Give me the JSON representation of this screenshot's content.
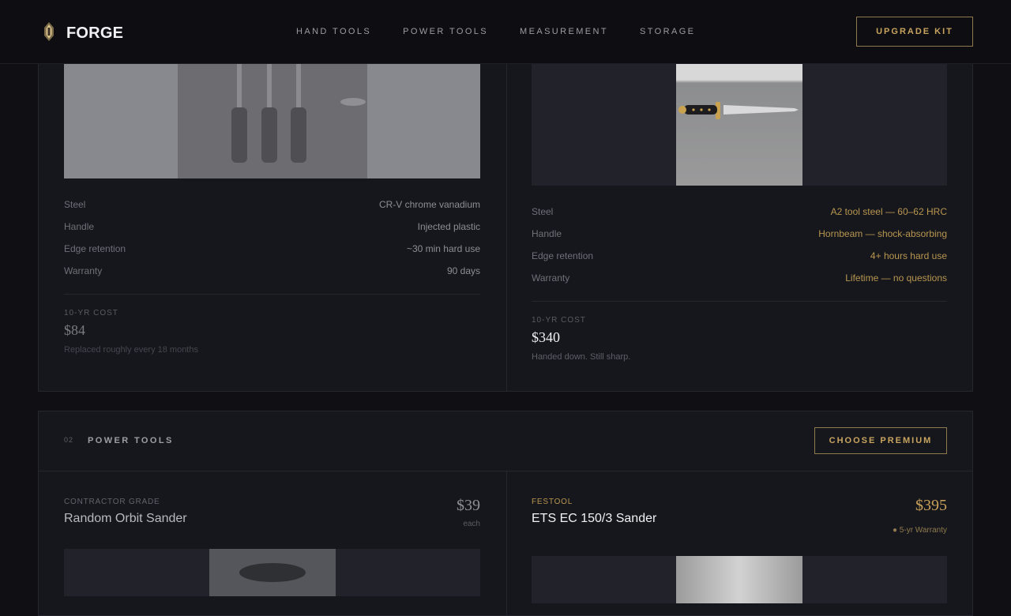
{
  "header": {
    "brand": "FORGE",
    "nav": [
      "HAND TOOLS",
      "POWER TOOLS",
      "MEASUREMENT",
      "STORAGE"
    ],
    "cta": "UPGRADE KIT"
  },
  "section1": {
    "budget": {
      "specs": [
        {
          "label": "Steel",
          "value": "CR-V chrome vanadium"
        },
        {
          "label": "Handle",
          "value": "Injected plastic"
        },
        {
          "label": "Edge retention",
          "value": "~30 min hard use"
        },
        {
          "label": "Warranty",
          "value": "90 days"
        }
      ],
      "cost_label": "10-YR COST",
      "cost": "$84",
      "cost_note": "Replaced roughly every 18 months"
    },
    "premium": {
      "specs": [
        {
          "label": "Steel",
          "value": "A2 tool steel — 60–62 HRC"
        },
        {
          "label": "Handle",
          "value": "Hornbeam — shock-absorbing"
        },
        {
          "label": "Edge retention",
          "value": "4+ hours hard use"
        },
        {
          "label": "Warranty",
          "value": "Lifetime — no questions"
        }
      ],
      "cost_label": "10-YR COST",
      "cost": "$340",
      "cost_note": "Handed down. Still sharp."
    }
  },
  "section2": {
    "number": "02",
    "title": "POWER TOOLS",
    "cta": "CHOOSE PREMIUM",
    "budget": {
      "grade": "CONTRACTOR GRADE",
      "name": "Random Orbit Sander",
      "price": "$39",
      "price_note": "each"
    },
    "premium": {
      "grade": "FESTOOL",
      "name": "ETS EC 150/3 Sander",
      "price": "$395",
      "price_note": "● 5-yr Warranty"
    }
  },
  "colors": {
    "background": "#0f0f14",
    "panel": "#16171d",
    "accent_gold": "#c8a45f"
  }
}
